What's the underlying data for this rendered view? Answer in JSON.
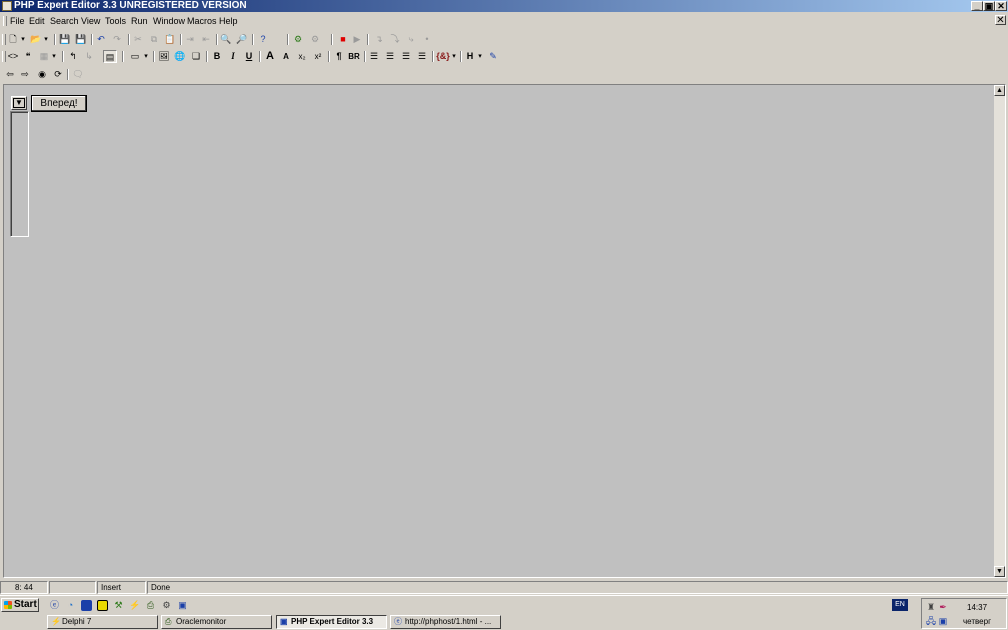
{
  "window": {
    "title": "PHP Expert Editor 3.3 UNREGISTERED VERSION",
    "controls": {
      "minimize": "_",
      "maximize": "▣",
      "close": "✕"
    }
  },
  "menu": [
    "File",
    "Edit",
    "Search",
    "View",
    "Tools",
    "Run",
    "Window",
    "Macros",
    "Help"
  ],
  "toolbar": {
    "bold": "B",
    "italic": "I",
    "underline": "U",
    "paragraph": "¶",
    "br": "BR",
    "heading": "H"
  },
  "form": {
    "forward_button": "Вперед!",
    "dropdown_arrow": "▼"
  },
  "statusbar": {
    "position": "8: 44",
    "empty": "",
    "mode": "Insert",
    "message": "Done"
  },
  "taskbar": {
    "start_label": "Start",
    "language": "EN",
    "tasks": [
      {
        "label": "Delphi 7",
        "active": false
      },
      {
        "label": "Oraclemonitor",
        "active": false
      },
      {
        "label": "PHP Expert Editor 3.3",
        "active": true
      },
      {
        "label": "http://phphost/1.html - ...",
        "active": false
      }
    ],
    "clock": {
      "time": "14:37",
      "day": "четверг"
    }
  },
  "colors": {
    "titlebar_start": "#0a246a",
    "titlebar_end": "#a6caf0",
    "workspace": "#c0c0c0",
    "chrome": "#d4d0c8"
  }
}
